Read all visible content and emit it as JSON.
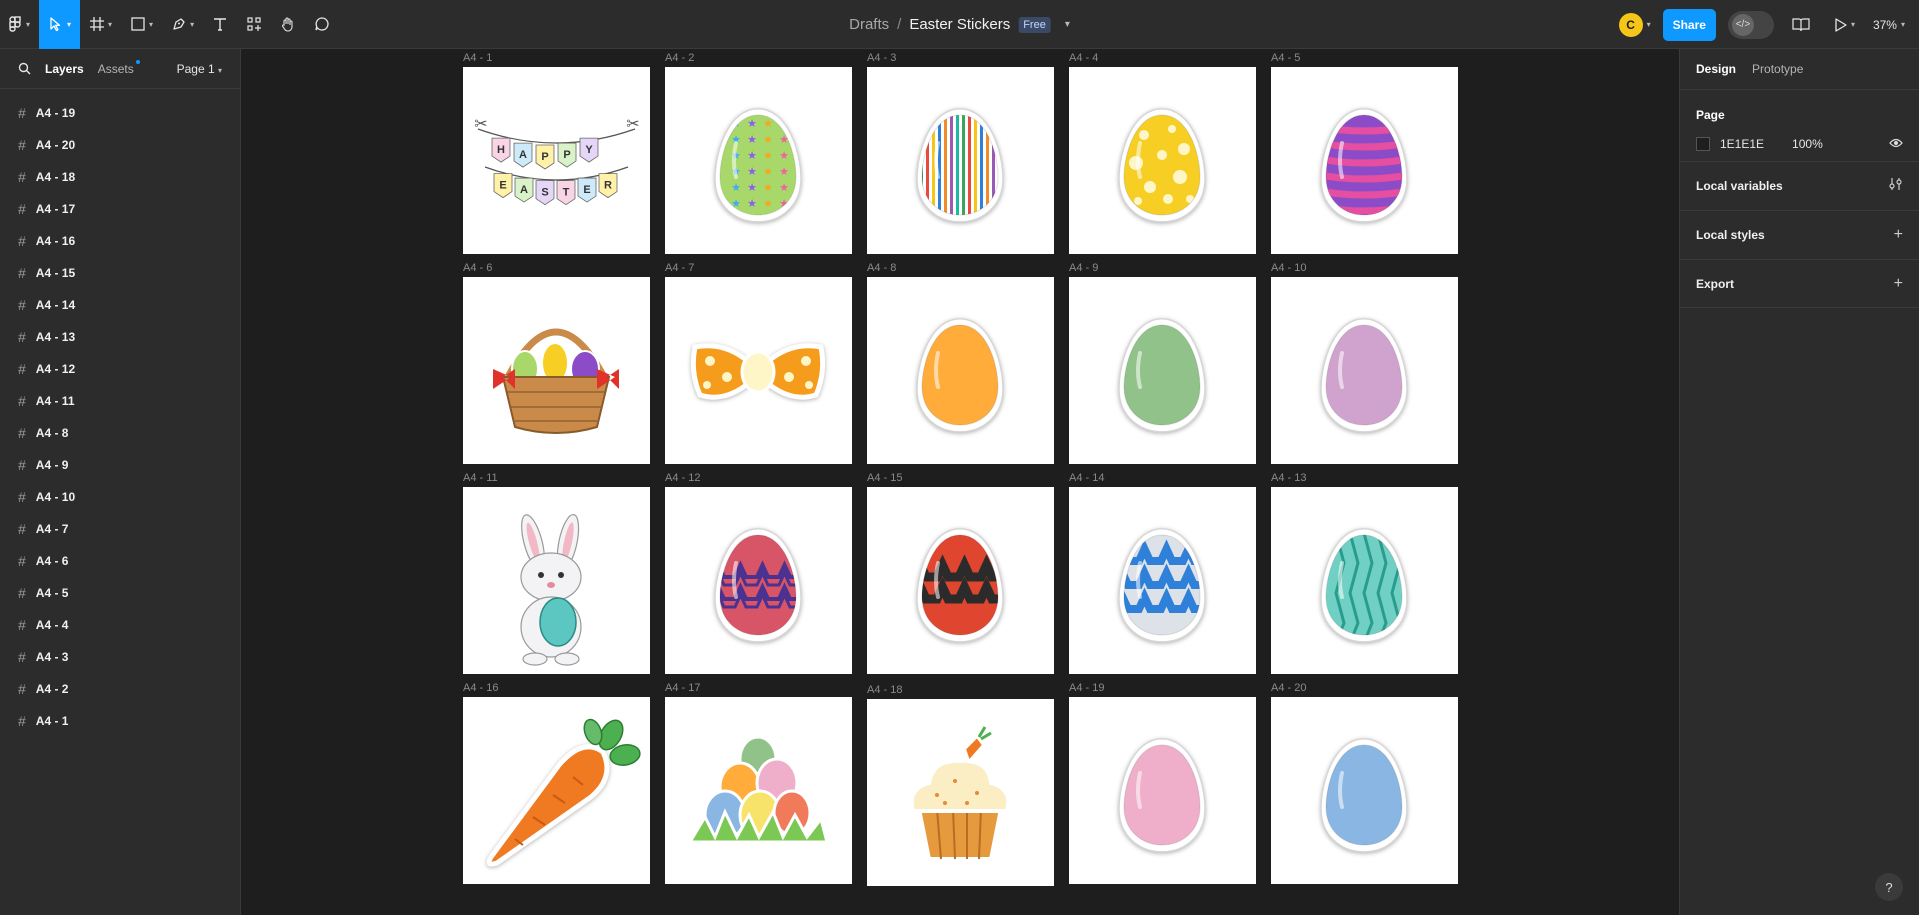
{
  "toolbar": {
    "tools": [
      "main-menu",
      "move-tool",
      "frame-tool",
      "shape-tool",
      "pen-tool",
      "text-tool",
      "actions-tool",
      "hand-tool",
      "comment-tool"
    ],
    "breadcrumb": {
      "drafts": "Drafts",
      "separator": "/",
      "file_name": "Easter Stickers",
      "plan_badge": "Free"
    },
    "avatar_initial": "C",
    "share_label": "Share",
    "zoom": "37%"
  },
  "left_panel": {
    "tabs": {
      "layers": "Layers",
      "assets": "Assets"
    },
    "page_selector": "Page 1",
    "layers": [
      "A4 - 19",
      "A4 - 20",
      "A4 - 18",
      "A4 - 17",
      "A4 - 16",
      "A4 - 15",
      "A4 - 14",
      "A4 - 13",
      "A4 - 12",
      "A4 - 11",
      "A4 - 8",
      "A4 - 9",
      "A4 - 10",
      "A4 - 7",
      "A4 - 6",
      "A4 - 5",
      "A4 - 4",
      "A4 - 3",
      "A4 - 2",
      "A4 - 1"
    ]
  },
  "right_panel": {
    "tabs": {
      "design": "Design",
      "prototype": "Prototype"
    },
    "page_section": {
      "title": "Page",
      "color_hex": "1E1E1E",
      "opacity": "100%"
    },
    "local_variables": "Local variables",
    "local_styles": "Local styles",
    "export": "Export",
    "help": "?"
  },
  "canvas": {
    "frames": [
      {
        "label": "A4 - 1",
        "sticker": "happy-easter-banner-sticker",
        "banner_text_top": "HAPPY",
        "banner_text_bottom": "EASTER"
      },
      {
        "label": "A4 - 2",
        "sticker": "green-star-egg-sticker",
        "color": "#a8d86a"
      },
      {
        "label": "A4 - 3",
        "sticker": "striped-egg-sticker",
        "color": "#f2b233"
      },
      {
        "label": "A4 - 4",
        "sticker": "yellow-dotted-egg-sticker",
        "color": "#f7cf24"
      },
      {
        "label": "A4 - 5",
        "sticker": "purple-pink-striped-egg-sticker",
        "color": "#8d4cc7"
      },
      {
        "label": "A4 - 6",
        "sticker": "easter-basket-sticker",
        "color": "#c98a4a"
      },
      {
        "label": "A4 - 7",
        "sticker": "orange-bow-sticker",
        "color": "#f59c1c"
      },
      {
        "label": "A4 - 8",
        "sticker": "orange-egg-sticker",
        "color": "#ffac3a"
      },
      {
        "label": "A4 - 9",
        "sticker": "green-egg-sticker",
        "color": "#90c28a"
      },
      {
        "label": "A4 - 10",
        "sticker": "lilac-egg-sticker",
        "color": "#d0a3cf"
      },
      {
        "label": "A4 - 11",
        "sticker": "bunny-with-egg-sticker",
        "color": "#5cc6c1"
      },
      {
        "label": "A4 - 12",
        "sticker": "red-zigzag-egg-sticker",
        "color": "#d85567"
      },
      {
        "label": "A4 - 15",
        "sticker": "red-black-zigzag-egg-sticker",
        "color": "#e0452f"
      },
      {
        "label": "A4 - 14",
        "sticker": "blue-zigzag-egg-sticker",
        "color": "#2f80d8"
      },
      {
        "label": "A4 - 13",
        "sticker": "teal-zigzag-egg-sticker",
        "color": "#6fd0c3"
      },
      {
        "label": "A4 - 16",
        "sticker": "carrot-sticker",
        "color": "#f07a22"
      },
      {
        "label": "A4 - 17",
        "sticker": "egg-pile-grass-sticker",
        "color": "#7cc855"
      },
      {
        "label": "A4 - 18",
        "sticker": "cupcake-carrot-sticker",
        "color": "#e69a3e"
      },
      {
        "label": "A4 - 19",
        "sticker": "pink-egg-sticker",
        "color": "#efaec9"
      },
      {
        "label": "A4 - 20",
        "sticker": "blue-egg-sticker",
        "color": "#8ab6e4"
      }
    ]
  }
}
